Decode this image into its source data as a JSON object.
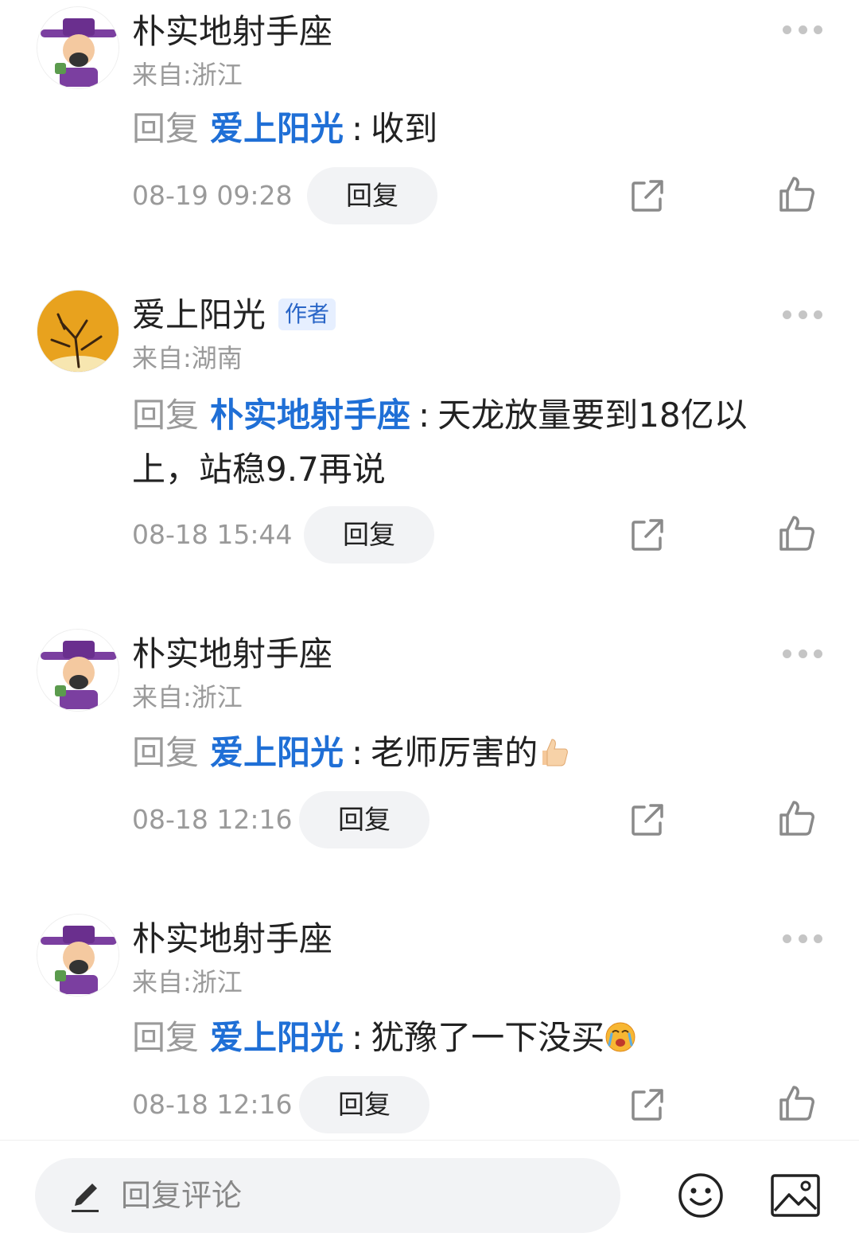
{
  "comments": [
    {
      "name": "朴实地射手座",
      "location": "来自:浙江",
      "reply_prefix": "回复",
      "mention": "爱上阳光",
      "separator": ":",
      "text": "收到",
      "time": "08-19 09:28",
      "reply_label": "回复",
      "avatar": "cartoon-avatar"
    },
    {
      "name": "爱上阳光",
      "author_badge": "作者",
      "location": "来自:湖南",
      "reply_prefix": "回复",
      "mention": "朴实地射手座",
      "separator": ":",
      "text": "天龙放量要到18亿以上，站稳9.7再说",
      "time": "08-18 15:44",
      "reply_label": "回复",
      "avatar": "tree-photo-avatar"
    },
    {
      "name": "朴实地射手座",
      "location": "来自:浙江",
      "reply_prefix": "回复",
      "mention": "爱上阳光",
      "separator": ":",
      "text": "老师厉害的",
      "emoji": "thumbs-up",
      "time": "08-18 12:16",
      "reply_label": "回复",
      "avatar": "cartoon-avatar"
    },
    {
      "name": "朴实地射手座",
      "location": "来自:浙江",
      "reply_prefix": "回复",
      "mention": "爱上阳光",
      "separator": ":",
      "text": "犹豫了一下没买",
      "emoji": "crying-face",
      "time": "08-18 12:16",
      "reply_label": "回复",
      "avatar": "cartoon-avatar"
    }
  ],
  "bottom_bar": {
    "input_placeholder": "回复评论",
    "icons": [
      "pen-icon",
      "smile-icon",
      "image-icon"
    ]
  },
  "colors": {
    "mention": "#1f6fd6",
    "muted": "#9a9a9a",
    "pill": "#f2f3f5",
    "badge_bg": "#e6efff",
    "badge_text": "#2a66c7"
  }
}
